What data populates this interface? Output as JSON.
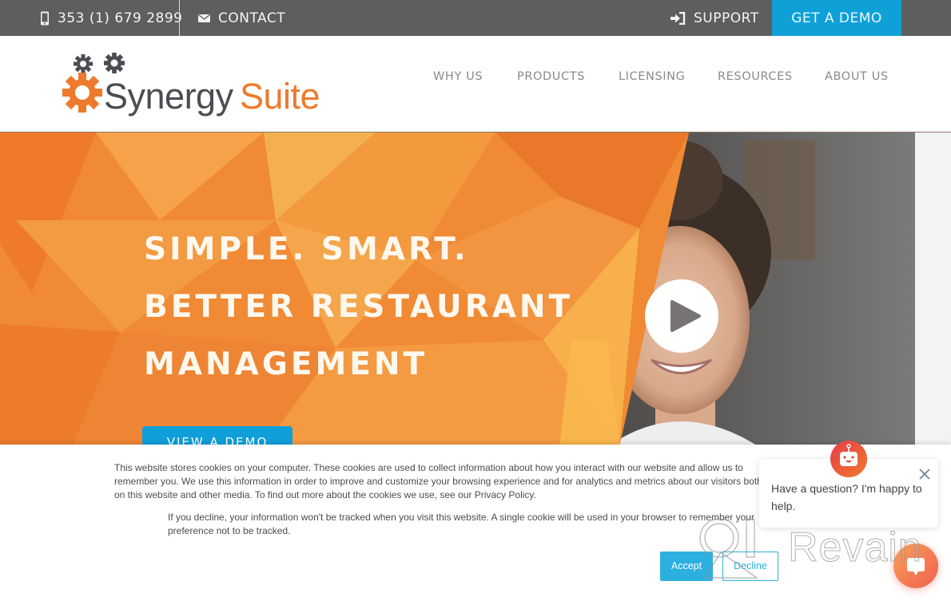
{
  "topbar": {
    "phone_icon": "mobile-phone-icon",
    "phone": "353 (1) 679 2899",
    "contact_icon": "envelope-icon",
    "contact": "CONTACT",
    "support_icon": "sign-in-icon",
    "support": "SUPPORT",
    "demo": "GET A DEMO",
    "colors": {
      "bar": "#5e5e5e",
      "demo": "#0fa0d8"
    }
  },
  "header": {
    "logo": {
      "word1": "Synergy",
      "word2": "Suite",
      "icon": "gears-icon"
    },
    "nav": [
      "WHY US",
      "PRODUCTS",
      "LICENSING",
      "RESOURCES",
      "ABOUT US"
    ]
  },
  "hero": {
    "lines": [
      "SIMPLE. SMART.",
      "BETTER RESTAURANT",
      "MANAGEMENT"
    ],
    "button": "VIEW A DEMO",
    "play_icon": "play-icon",
    "colors": {
      "orange": "#f08a34",
      "button": "#109fd9"
    }
  },
  "cookie_banner": {
    "text1": "This website stores cookies on your computer. These cookies are used to collect information about how you interact with our website and allow us to remember you. We use this information in order to improve and customize your browsing experience and for analytics and metrics about our visitors both on this website and other media. To find out more about the cookies we use, see our Privacy Policy.",
    "text2": "If you decline, your information won't be tracked when you visit this website. A single cookie will be used in your browser to remember your preference not to be tracked.",
    "accept": "Accept",
    "decline": "Decline"
  },
  "chat": {
    "message": "Have a question? I'm happy to help.",
    "close_icon": "close-icon",
    "avatar_icon": "robot-icon",
    "launcher_icon": "chat-icon"
  },
  "watermark": {
    "text": "Revain"
  }
}
